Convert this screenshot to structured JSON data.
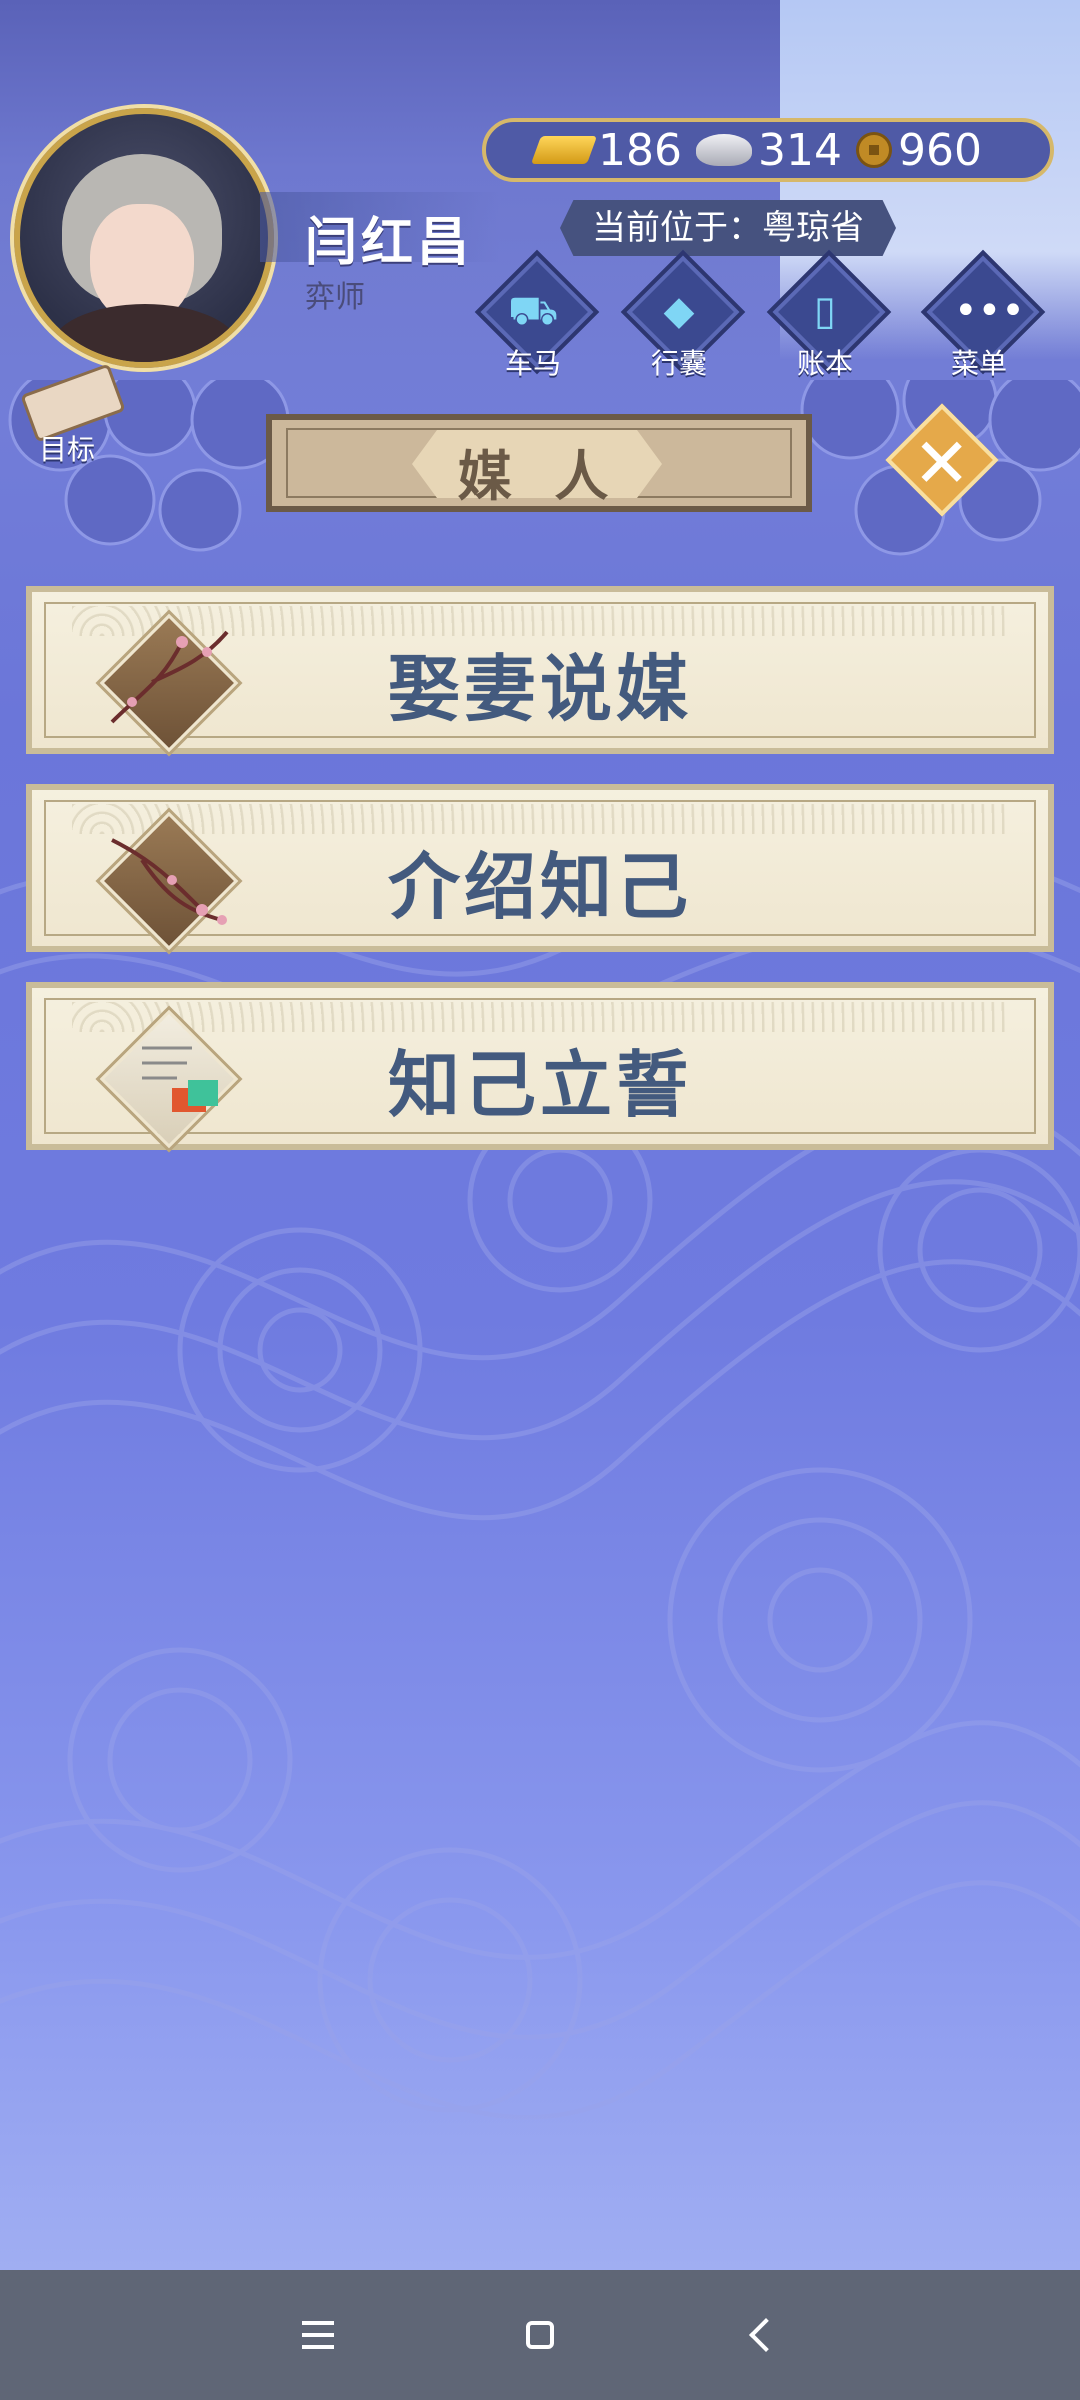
{
  "player": {
    "name": "闫红昌",
    "title": "弈师"
  },
  "currency": {
    "gold": "186",
    "silver": "314",
    "copper": "960"
  },
  "location_text": "当前位于：粤琼省",
  "toolbar": [
    {
      "label": "车马",
      "icon": "carriage-icon"
    },
    {
      "label": "行囊",
      "icon": "bundle-icon"
    },
    {
      "label": "账本",
      "icon": "ledger-icon"
    },
    {
      "label": "菜单",
      "icon": "more-icon"
    }
  ],
  "goal_label": "目标",
  "panel_title": "媒 人",
  "menu": [
    {
      "label": "娶妻说媒",
      "icon": "plum-blossom-icon"
    },
    {
      "label": "介绍知己",
      "icon": "plum-blossom-icon"
    },
    {
      "label": "知己立誓",
      "icon": "letter-icon"
    }
  ],
  "colors": {
    "accent_gold": "#d6b86a",
    "card_text": "#435a7e",
    "background": "#6f7be0"
  }
}
